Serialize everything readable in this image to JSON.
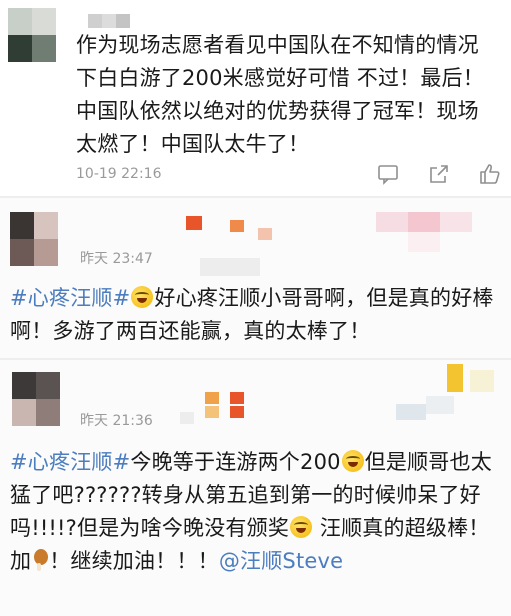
{
  "comments": [
    {
      "body_text": "作为现场志愿者看见中国队在不知情的情况下白白游了200米感觉好可惜 不过！最后！中国队依然以绝对的优势获得了冠军！现场太燃了！中国队太牛了！",
      "timestamp": "10-19 22:16",
      "actions": [
        "comment-icon",
        "share-icon",
        "like-icon"
      ]
    },
    {
      "timestamp": "昨天 23:47",
      "hashtag": "#心疼汪顺#",
      "body_text": "好心疼汪顺小哥哥啊，但是真的好棒啊！多游了两百还能赢，真的太棒了！"
    },
    {
      "timestamp": "昨天 21:36",
      "hashtag1": "#心疼汪顺#",
      "text1": "今晚等于连游两个200",
      "text2": "但是顺哥也太猛了吧??????转身从第五追到第一的时候帅呆了好吗!!!!?但是为啥今晚没有颁奖",
      "text3": " 汪顺真的超级棒！加",
      "text4": "！继续加油！！！",
      "mention": "@汪顺Steve"
    }
  ],
  "colors": {
    "link": "#4b7dbf",
    "meta": "#9a9a9a",
    "separator": "#eeeeee"
  }
}
